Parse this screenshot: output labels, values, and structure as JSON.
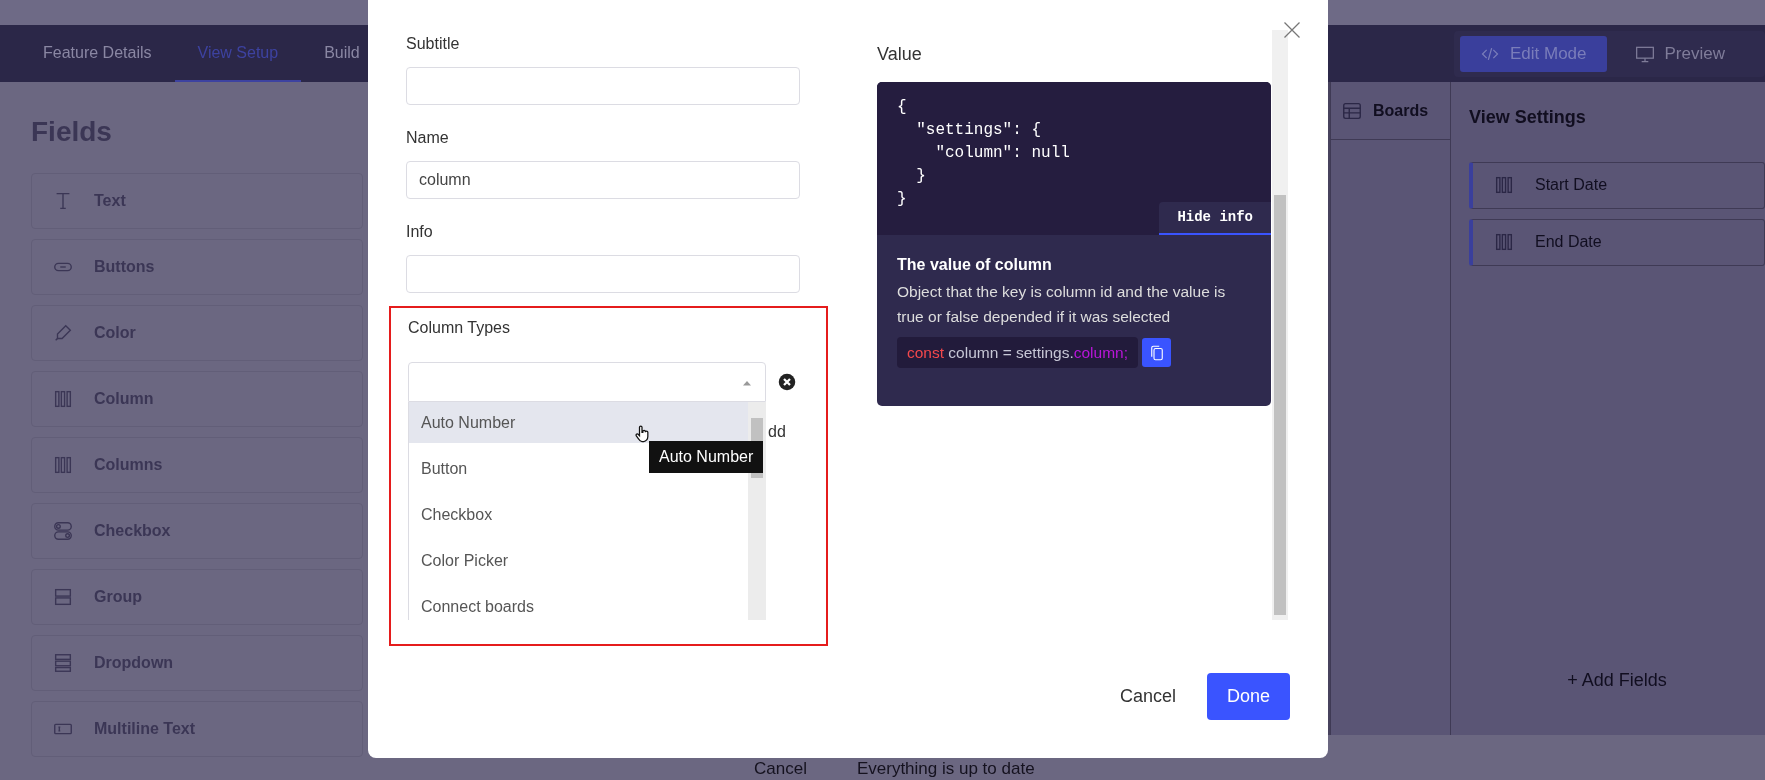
{
  "app": {
    "tabs": [
      {
        "label": "Feature Details",
        "selected": false
      },
      {
        "label": "View Setup",
        "selected": true
      },
      {
        "label": "Build",
        "selected": false
      }
    ],
    "mode_buttons": [
      {
        "label": "Edit Mode",
        "selected": true,
        "kind": "code"
      },
      {
        "label": "Preview",
        "selected": false,
        "kind": "monitor"
      }
    ]
  },
  "fields_panel": {
    "title": "Fields",
    "items": [
      {
        "label": "Text",
        "kind": "text"
      },
      {
        "label": "Buttons",
        "kind": "buttons"
      },
      {
        "label": "Color",
        "kind": "color"
      },
      {
        "label": "Column",
        "kind": "column"
      },
      {
        "label": "Columns",
        "kind": "column"
      },
      {
        "label": "Checkbox",
        "kind": "checkbox"
      },
      {
        "label": "Group",
        "kind": "group"
      },
      {
        "label": "Dropdown",
        "kind": "dropdown"
      },
      {
        "label": "Multiline Text",
        "kind": "multiline"
      }
    ]
  },
  "boards_tab": {
    "label": "Boards"
  },
  "view_settings": {
    "title": "View Settings",
    "items": [
      {
        "label": "Start Date"
      },
      {
        "label": "End Date"
      }
    ],
    "add_button": "+ Add Fields"
  },
  "footer_bar": {
    "cancel": "Cancel",
    "status": "Everything is up to date"
  },
  "dialog": {
    "fields": [
      {
        "label": "Subtitle"
      },
      {
        "label": "Name",
        "value": "column"
      },
      {
        "label": "Info"
      }
    ],
    "column_types": {
      "label": "Column Types",
      "highlighted": true,
      "options": [
        {
          "label": "Auto Number",
          "hovered": true
        },
        {
          "label": "Button",
          "hovered": false
        },
        {
          "label": "Checkbox",
          "hovered": false
        },
        {
          "label": "Color Picker",
          "hovered": false
        },
        {
          "label": "Connect boards",
          "hovered": false
        }
      ],
      "tooltip": "Auto Number",
      "add_label": "dd"
    },
    "value_panel": {
      "title": "Value",
      "code": "{\n  \"settings\": {\n    \"column\": null\n  }\n}",
      "toggle": "Hide info",
      "info_title": "The value of column",
      "info_text": "Object that the key is column id and the value is true or false depended if it was selected",
      "snippet": [
        {
          "text": "const",
          "kind": "keyword"
        },
        {
          "text": " column = settings.",
          "kind": "plain"
        },
        {
          "text": "column;",
          "kind": "property"
        }
      ]
    },
    "buttons": [
      {
        "label": "Cancel",
        "kind": "link"
      },
      {
        "label": "Done",
        "kind": "primary"
      }
    ]
  }
}
